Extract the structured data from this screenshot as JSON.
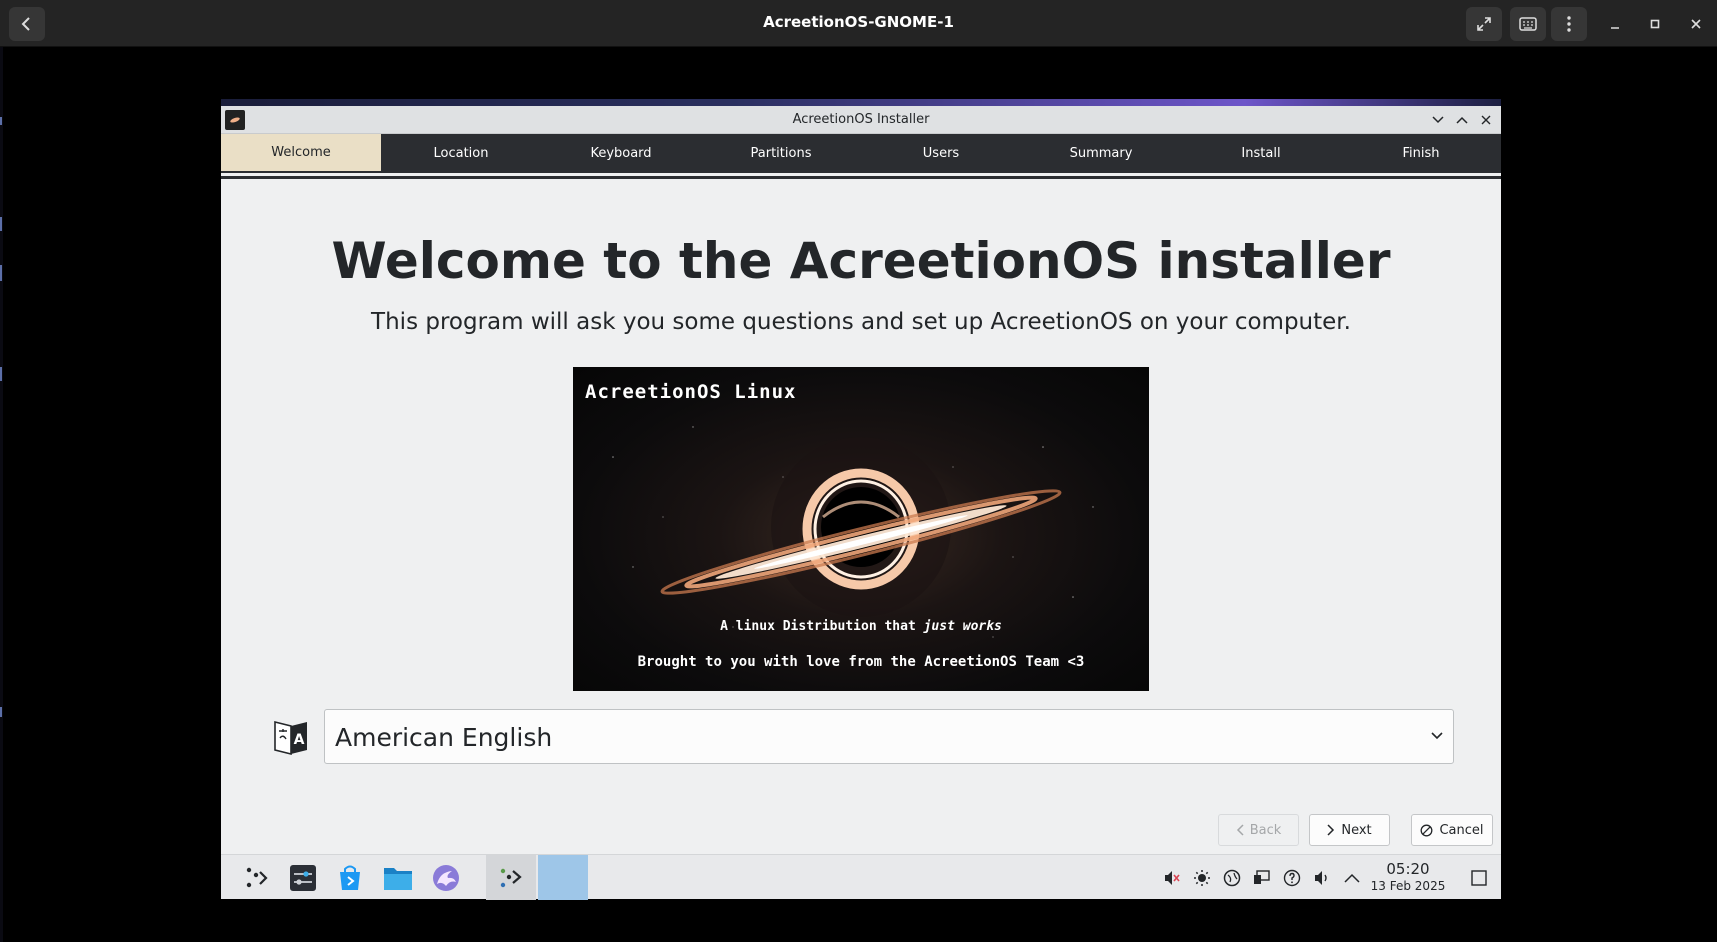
{
  "host": {
    "title": "AcreetionOS-GNOME-1",
    "icons": [
      "back-arrow-icon",
      "fullscreen-icon",
      "keyboard-icon",
      "kebab-menu-icon",
      "minimize-icon",
      "maximize-icon",
      "close-icon"
    ]
  },
  "installer": {
    "window_title": "AcreetionOS Installer",
    "steps": [
      "Welcome",
      "Location",
      "Keyboard",
      "Partitions",
      "Users",
      "Summary",
      "Install",
      "Finish"
    ],
    "active_step": "Welcome",
    "heading": "Welcome to the AcreetionOS installer",
    "subheading": "This program will ask you some questions and set up AcreetionOS on your computer.",
    "banner": {
      "title": "AcreetionOS Linux",
      "tagline_prefix": "A linux Distribution that",
      "tagline_emphasis": "just works",
      "credit": "Brought to you with love from the AcreetionOS Team <3"
    },
    "language": {
      "selected": "American English"
    },
    "buttons": {
      "back": "Back",
      "next": "Next",
      "cancel": "Cancel"
    }
  },
  "taskbar": {
    "apps": [
      "app-launcher-icon",
      "system-settings-icon",
      "discover-store-icon",
      "file-manager-icon",
      "web-browser-icon",
      "installer-icon"
    ],
    "tray": [
      "muted-speaker-icon",
      "brightness-icon",
      "network-icon",
      "display-icon",
      "help-icon",
      "volume-icon",
      "show-hidden-icon"
    ],
    "time": "05:20",
    "date": "13 Feb 2025"
  },
  "colors": {
    "step_bar": "#2b2d31",
    "active_step": "#eadfc6",
    "window_bg": "#eff0f1"
  }
}
